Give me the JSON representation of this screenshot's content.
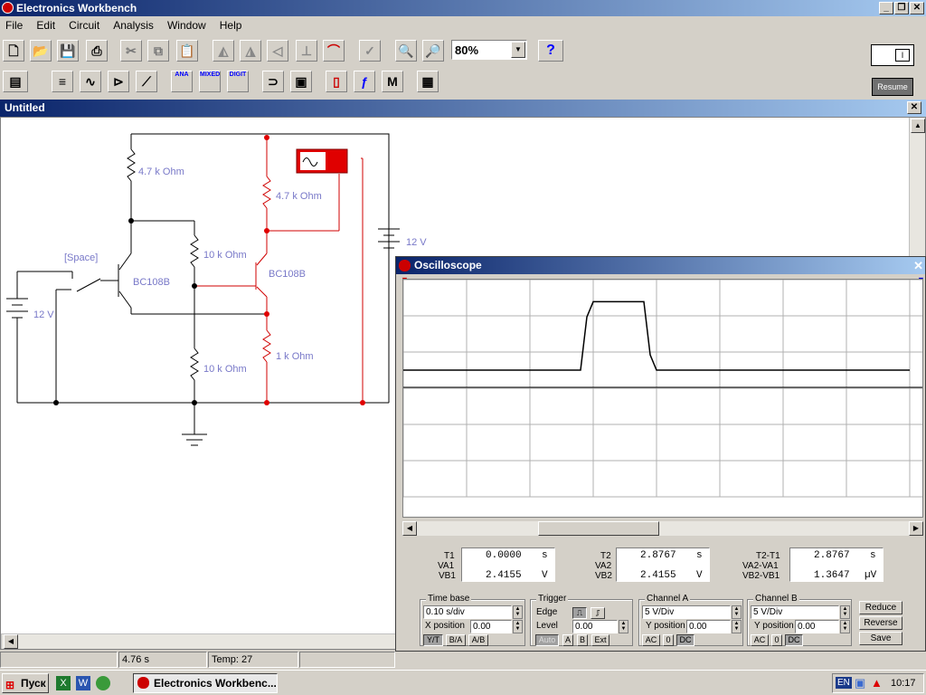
{
  "app": {
    "title": "Electronics Workbench"
  },
  "menu": [
    "File",
    "Edit",
    "Circuit",
    "Analysis",
    "Window",
    "Help"
  ],
  "toolbar": {
    "zoom_value": "80%",
    "help_label": "?",
    "resume_label": "Resume",
    "ana_label": "ANA",
    "mixed_label": "MIXED",
    "digit_label": "DIGIT",
    "m_label": "M"
  },
  "document": {
    "title": "Untitled"
  },
  "circuit": {
    "labels": {
      "r1": "4.7 k Ohm",
      "r2": "4.7 k Ohm",
      "r3": "10 k Ohm",
      "r4": "10 k Ohm",
      "r5": "1 k Ohm",
      "q1": "BC108B",
      "q2": "BC108B",
      "switch_key": "[Space]",
      "batt1": "12 V",
      "batt2": "12 V"
    }
  },
  "oscilloscope": {
    "title": "Oscilloscope",
    "meas": {
      "t1_label": "T1",
      "va1_label": "VA1",
      "vb1_label": "VB1",
      "t1_value": "0.0000",
      "t1_unit": "s",
      "vb1_value": "2.4155",
      "vb1_unit": "V",
      "t2_label": "T2",
      "va2_label": "VA2",
      "vb2_label": "VB2",
      "t2_value": "2.8767",
      "t2_unit": "s",
      "vb2_value": "2.4155",
      "vb2_unit": "V",
      "dt_label": "T2-T1",
      "dva_label": "VA2-VA1",
      "dvb_label": "VB2-VB1",
      "dt_value": "2.8767",
      "dt_unit": "s",
      "dvb_value": "1.3647",
      "dvb_unit": "µV"
    },
    "timebase": {
      "legend": "Time base",
      "value": "0.10 s/div",
      "xpos_label": "X position",
      "xpos_value": "0.00",
      "yt": "Y/T",
      "ba": "B/A",
      "ab": "A/B"
    },
    "trigger": {
      "legend": "Trigger",
      "edge_label": "Edge",
      "level_label": "Level",
      "level_value": "0.00",
      "auto": "Auto",
      "a": "A",
      "b": "B",
      "ext": "Ext"
    },
    "channel_a": {
      "legend": "Channel A",
      "value": "5  V/Div",
      "ypos_label": "Y position",
      "ypos_value": "0.00",
      "ac": "AC",
      "zero": "0",
      "dc": "DC"
    },
    "channel_b": {
      "legend": "Channel B",
      "value": "5  V/Div",
      "ypos_label": "Y position",
      "ypos_value": "0.00",
      "ac": "AC",
      "zero": "0",
      "dc": "DC"
    },
    "buttons": {
      "reduce": "Reduce",
      "reverse": "Reverse",
      "save": "Save"
    }
  },
  "chart_data": {
    "type": "line",
    "series": [
      {
        "values": [
          0,
          0,
          0,
          0,
          0,
          0,
          0,
          0,
          0,
          0,
          0,
          0,
          0,
          0,
          0,
          0,
          0,
          0,
          0,
          0,
          0,
          0,
          0,
          0,
          0,
          0,
          0,
          0,
          0,
          2.8,
          3.6,
          3.6,
          3.6,
          3.6,
          3.6,
          3.6,
          3.6,
          3.6,
          3.6,
          0.8,
          0,
          0,
          0,
          0,
          0,
          0,
          0,
          0,
          0,
          0,
          0,
          0,
          0,
          0,
          0,
          0,
          0,
          0,
          0,
          0,
          0,
          0,
          0,
          0,
          0,
          0,
          0,
          0,
          0,
          0,
          0,
          0,
          0,
          0,
          0,
          0,
          0,
          0,
          0,
          0,
          0
        ]
      }
    ]
  },
  "status": {
    "time": "4.76 s",
    "temp": "Temp:  27"
  },
  "taskbar": {
    "start": "Пуск",
    "task": "Electronics Workbenc...",
    "lang": "EN",
    "clock": "10:17"
  }
}
